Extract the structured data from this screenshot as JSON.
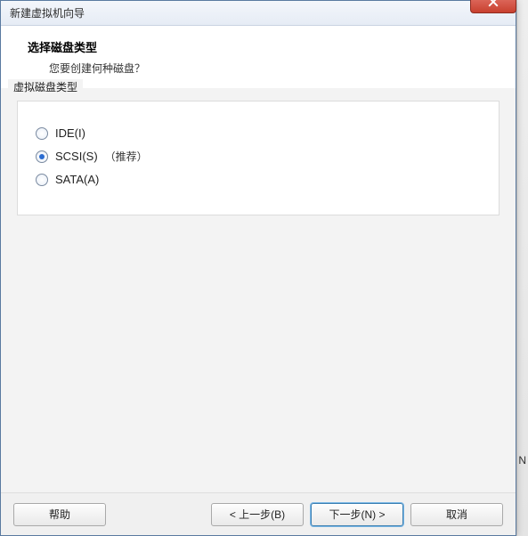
{
  "window": {
    "title": "新建虚拟机向导"
  },
  "header": {
    "title": "选择磁盘类型",
    "subtitle": "您要创建何种磁盘？"
  },
  "group": {
    "label": "虚拟磁盘类型",
    "options": [
      {
        "label": "IDE(I)",
        "checked": false,
        "hint": ""
      },
      {
        "label": "SCSI(S)",
        "checked": true,
        "hint": "（推荐）"
      },
      {
        "label": "SATA(A)",
        "checked": false,
        "hint": ""
      }
    ]
  },
  "buttons": {
    "help": "帮助",
    "back": "< 上一步(B)",
    "next": "下一步(N) >",
    "cancel": "取消"
  }
}
